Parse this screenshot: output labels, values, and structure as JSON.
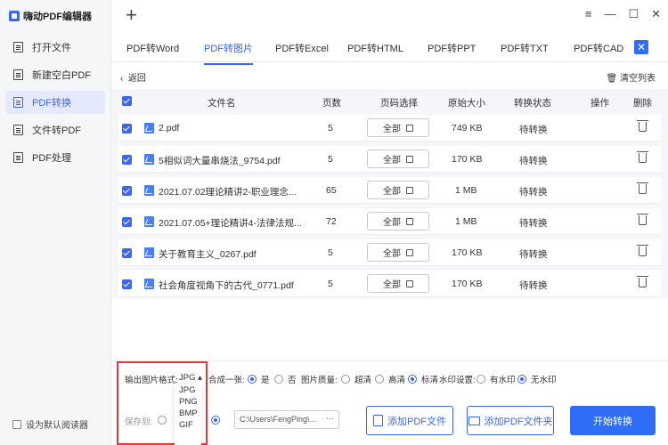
{
  "app": {
    "title": "嗨动PDF编辑器"
  },
  "sidebar": {
    "items": [
      {
        "label": "打开文件",
        "icon": "open-file-icon"
      },
      {
        "label": "新建空白PDF",
        "icon": "new-pdf-icon"
      },
      {
        "label": "PDF转换",
        "icon": "pdf-convert-icon",
        "active": true
      },
      {
        "label": "文件转PDF",
        "icon": "file-to-pdf-icon"
      },
      {
        "label": "PDF处理",
        "icon": "pdf-process-icon"
      }
    ],
    "default_reader": "设为默认阅读器"
  },
  "window": {
    "menu": "≡",
    "minimize": "—",
    "maximize": "☐",
    "close": "✕",
    "add": "+"
  },
  "tabs": [
    {
      "label": "PDF转Word"
    },
    {
      "label": "PDF转图片",
      "active": true
    },
    {
      "label": "PDF转Excel"
    },
    {
      "label": "PDF转HTML"
    },
    {
      "label": "PDF转PPT"
    },
    {
      "label": "PDF转TXT"
    },
    {
      "label": "PDF转CAD"
    }
  ],
  "back": "返回",
  "clear_list": "清空列表",
  "table": {
    "headers": {
      "filename": "文件名",
      "pages": "页数",
      "page_select": "页码选择",
      "orig_size": "原始大小",
      "status": "转换状态",
      "actions": "操作",
      "delete": "删除"
    },
    "rows": [
      {
        "name": "2.pdf",
        "pages": "5",
        "select": "全部",
        "size": "749 KB",
        "status": "待转换"
      },
      {
        "name": "5相似词大量串烧法_9754.pdf",
        "pages": "5",
        "select": "全部",
        "size": "170 KB",
        "status": "待转换"
      },
      {
        "name": "2021.07.02理论精讲2-职业理念...",
        "pages": "65",
        "select": "全部",
        "size": "1 MB",
        "status": "待转换"
      },
      {
        "name": "2021.07.05+理论精讲4-法律法规...",
        "pages": "72",
        "select": "全部",
        "size": "1 MB",
        "status": "待转换"
      },
      {
        "name": "关于教育主义_0267.pdf",
        "pages": "5",
        "select": "全部",
        "size": "170 KB",
        "status": "待转换"
      },
      {
        "name": "社会角度视角下的古代_0771.pdf",
        "pages": "5",
        "select": "全部",
        "size": "170 KB",
        "status": "待转换"
      }
    ]
  },
  "options": {
    "format_label": "输出图片格式:",
    "format_value": "JPG",
    "format_options": [
      "JPG",
      "PNG",
      "BMP",
      "GIF"
    ],
    "merge_label": "合成一张:",
    "merge_yes": "是",
    "merge_no": "否",
    "quality_label": "图片质量:",
    "quality_options": [
      "超清",
      "高清",
      "标清"
    ],
    "watermark_label": "水印设置:",
    "watermark_options": [
      "有水印",
      "无水印"
    ]
  },
  "bottom": {
    "save_to": "保存到:",
    "path": "C:\\Users\\FengPing\\...",
    "more": "···",
    "add_file": "添加PDF文件",
    "add_folder": "添加PDF文件夹",
    "start": "开始转换"
  },
  "colors": {
    "accent": "#3a66f5",
    "highlight_box": "#e03a3a"
  }
}
